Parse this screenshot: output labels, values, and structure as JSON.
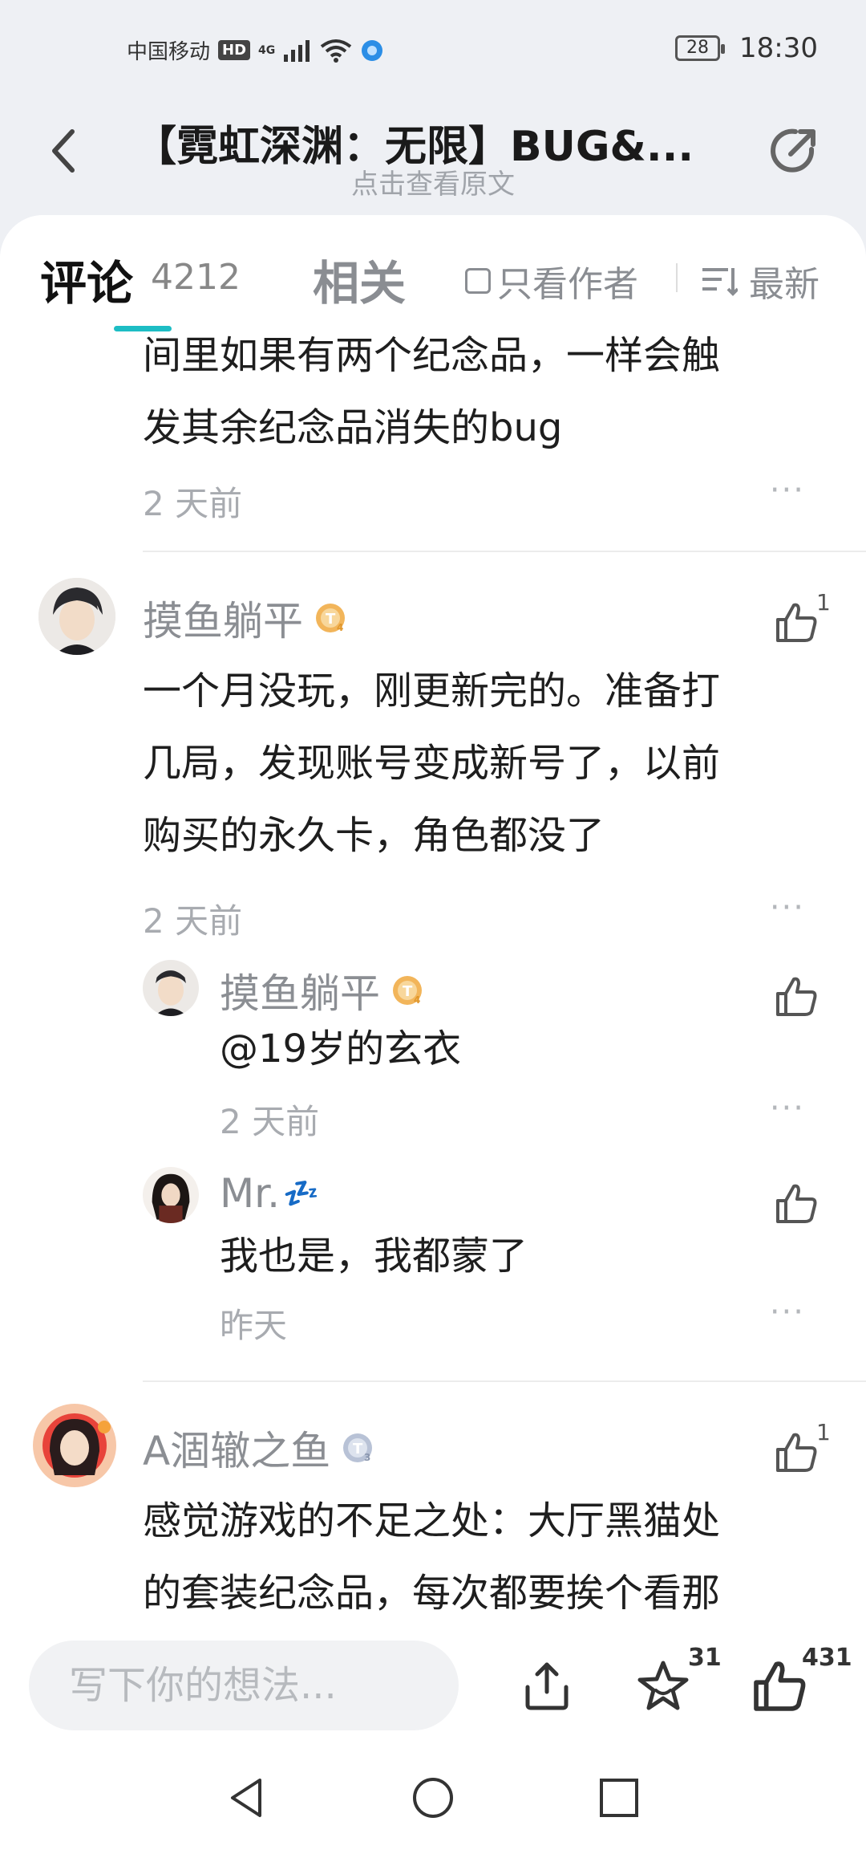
{
  "status_bar": {
    "carrier": "中国移动",
    "hd": "HD",
    "network": "4G",
    "battery": "28",
    "time": "18:30"
  },
  "nav": {
    "title": "【霓虹深渊：无限】BUG&...",
    "subtitle": "点击查看原文"
  },
  "tabs": {
    "comments_label": "评论",
    "comments_count": "4212",
    "related_label": "相关",
    "only_author_label": "只看作者",
    "sort_label": "最新"
  },
  "comments": [
    {
      "text_lines": [
        "间里如果有两个纪念品，一样会触",
        "发其余纪念品消失的bug"
      ],
      "time": "2 天前",
      "more": "···"
    },
    {
      "user": "摸鱼躺平",
      "level": "T4",
      "likes": "1",
      "text_lines": [
        "一个月没玩，刚更新完的。准备打",
        "几局，发现账号变成新号了，以前",
        "购买的永久卡，角色都没了"
      ],
      "time": "2 天前",
      "more": "···",
      "replies": [
        {
          "user": "摸鱼躺平",
          "level": "T4",
          "text": "@19岁的玄衣",
          "time": "2 天前",
          "more": "···"
        },
        {
          "user": "Mr.",
          "user_emoji": "💤",
          "text": "我也是，我都蒙了",
          "time": "昨天",
          "more": "···"
        }
      ]
    },
    {
      "user": "A涸辙之鱼",
      "level": "T3",
      "likes": "1",
      "text_lines": [
        "感觉游戏的不足之处：大厅黑猫处",
        "的套装纪念品，每次都要挨个看那"
      ]
    }
  ],
  "bottom_bar": {
    "input_placeholder": "写下你的想法...",
    "favorites_count": "31",
    "likes_count": "431"
  },
  "colors": {
    "accent": "#1dbdc4",
    "text_secondary": "#8b8e93",
    "level_badge": "#f2b55a"
  }
}
